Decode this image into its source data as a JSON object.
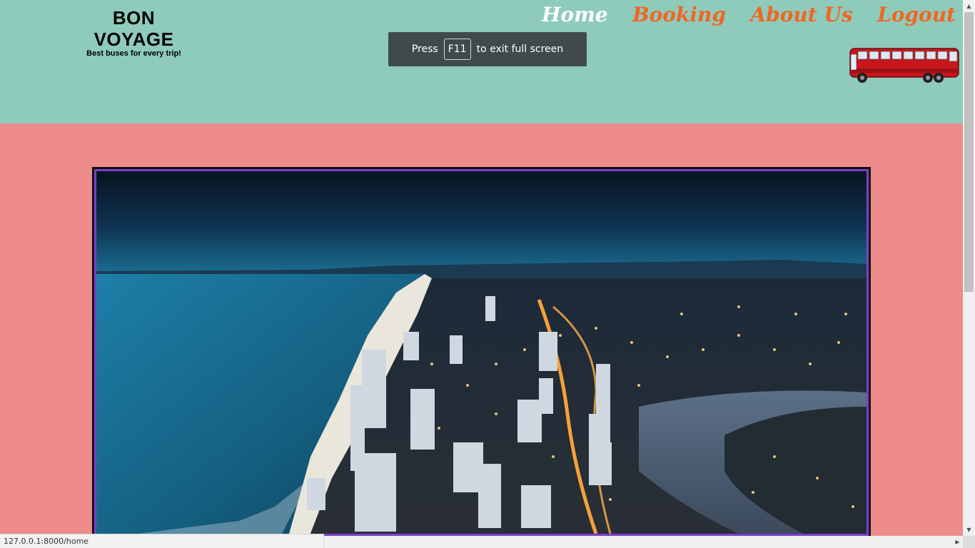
{
  "brand": {
    "title": "BON VOYAGE",
    "tagline": "Best buses for every trip!"
  },
  "nav": {
    "items": [
      {
        "label": "Home",
        "active": true
      },
      {
        "label": "Booking",
        "active": false
      },
      {
        "label": "About Us",
        "active": false
      },
      {
        "label": "Logout",
        "active": false
      }
    ]
  },
  "fullscreen_toast": {
    "prefix": "Press",
    "key": "F11",
    "suffix": "to exit full screen"
  },
  "hero": {
    "image": "coastal-city-night-aerial-photo"
  },
  "status_bar": {
    "url": "127.0.0.1:8000/home"
  },
  "colors": {
    "header_bg": "#8ecbbb",
    "page_bg": "#ee8b8b",
    "nav_link": "#f26522",
    "nav_active": "#ffffff",
    "hero_border": "#7a3fcf",
    "bus_body": "#c8161d"
  },
  "icons": {
    "bus": "bus-icon",
    "scroll_up": "chevron-up-icon",
    "scroll_down": "chevron-down-icon",
    "scroll_right": "chevron-right-icon"
  }
}
